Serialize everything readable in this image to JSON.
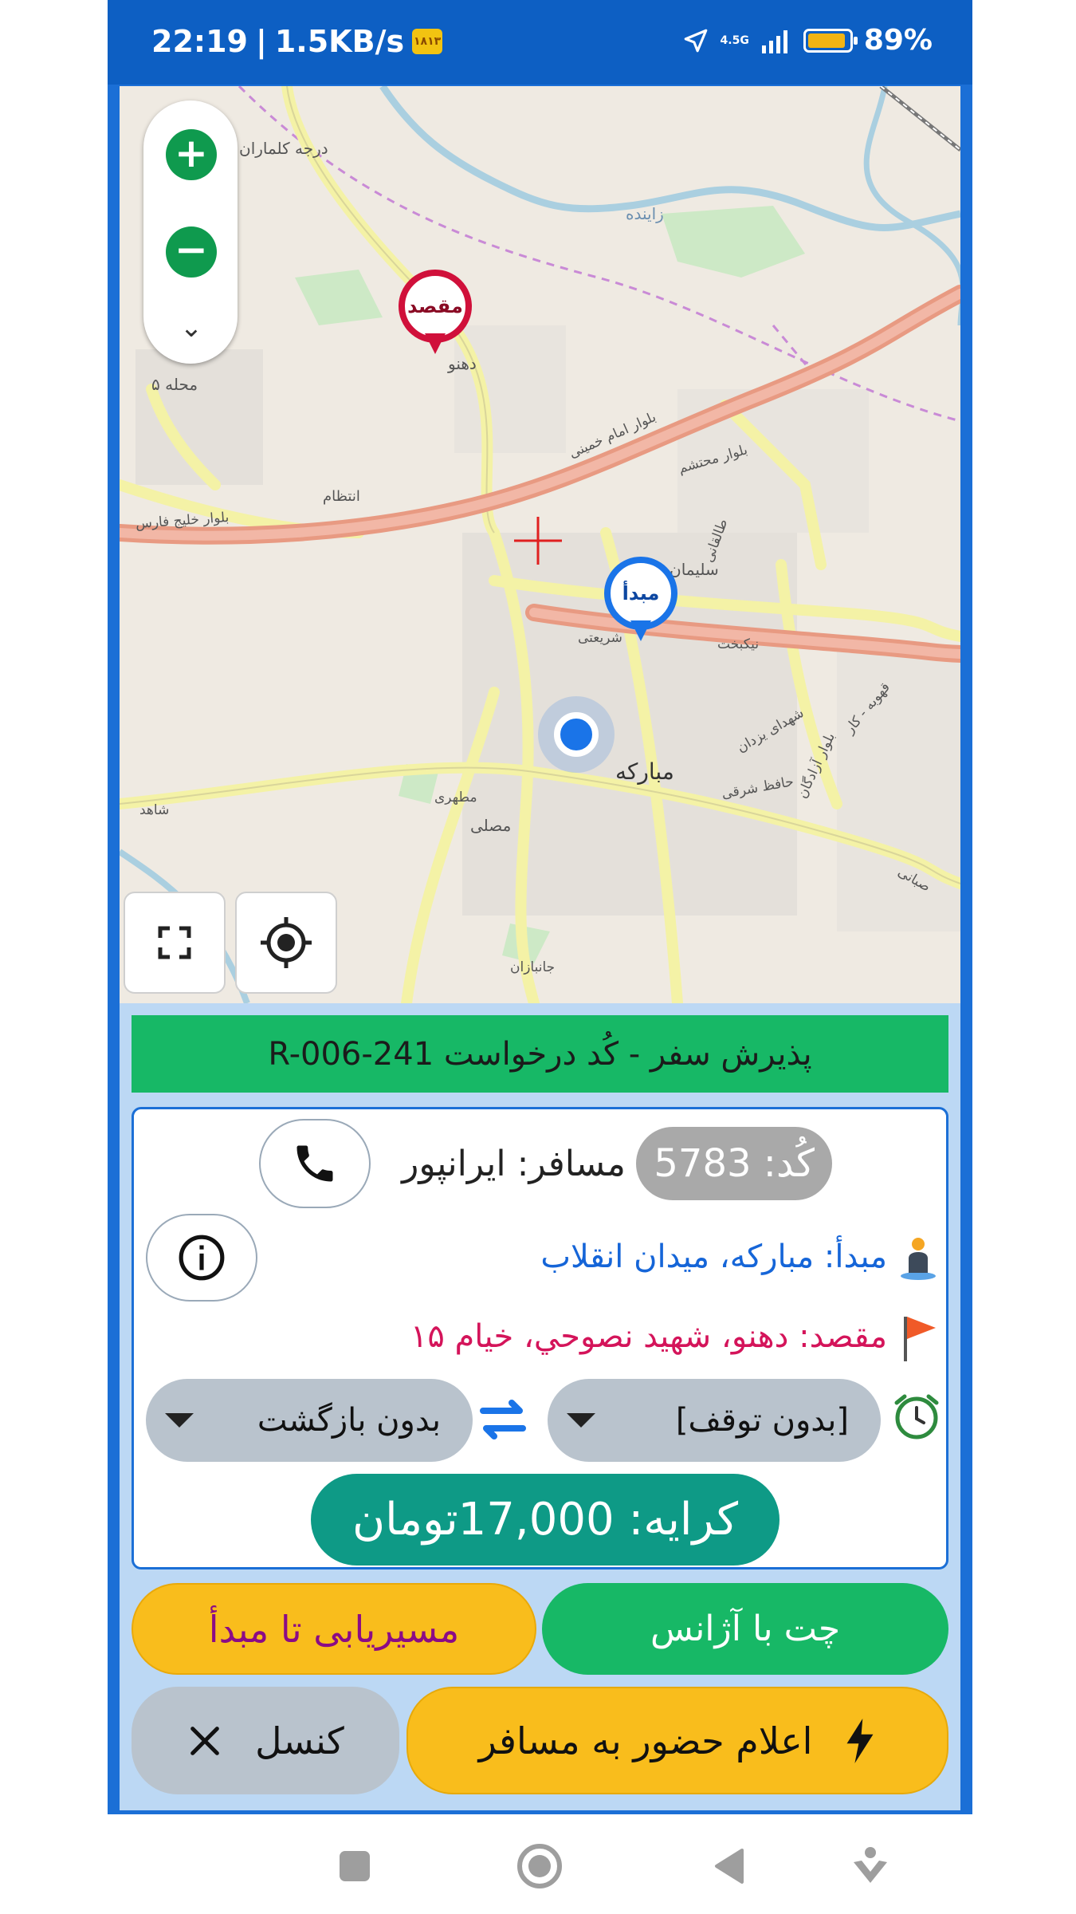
{
  "status_bar": {
    "time": "22:19",
    "separator": "|",
    "speed": "1.5KB/s",
    "chip_text": "۱۸۱۳",
    "network": "4.5G",
    "battery": "89%",
    "battery_level": 0.89
  },
  "map": {
    "labels": [
      "درجه کلماران",
      "زاینده",
      "دهنو",
      "محله ۵",
      "بلوار امام خمینی",
      "بلوار محتشم",
      "بلوار خلیج فارس",
      "انتظام",
      "سلیمان",
      "شریعتی",
      "نیکبخت",
      "طالقانی",
      "شهدای یزدان",
      "بلوار آزادگان",
      "مبارکه",
      "حافظ شرقی",
      "مصلی",
      "شاهد",
      "مطهری",
      "جانبازان",
      "صبانی",
      "قهوبه - کار"
    ],
    "destination_pin": "مقصد",
    "origin_pin": "مبدأ",
    "colors": {
      "destination": "#d0103a",
      "origin": "#1a74e8"
    }
  },
  "request": {
    "title": "پذیرش سفر - کُد درخواست R-006-241"
  },
  "card": {
    "code": "کُد: 5783",
    "passenger": "مسافر: ایرانپور",
    "origin": "مبدأ: مبارکه، میدان انقلاب",
    "destination": "مقصد: دهنو، شهيد نصوحي، خيام ۱۵",
    "stop_select": "[بدون توقف]",
    "return_select": "بدون بازگشت",
    "fare": "کرایه: 17,000تومان"
  },
  "actions": {
    "route": "مسیریابی تا مبدأ",
    "chat": "چت با آژانس",
    "announce": "اعلام حضور به مسافر",
    "cancel": "کنسل"
  },
  "icons": {
    "zoom_in": "plus-icon",
    "zoom_out": "minus-icon",
    "more": "chevron-down-icon",
    "fullscreen": "fullscreen-icon",
    "locate": "my-location-icon",
    "phone": "phone-icon",
    "info": "info-icon",
    "origin": "person-pin-icon",
    "destination": "flag-icon",
    "time": "clock-icon",
    "swap": "swap-icon",
    "bolt": "bolt-icon",
    "close": "close-icon"
  }
}
